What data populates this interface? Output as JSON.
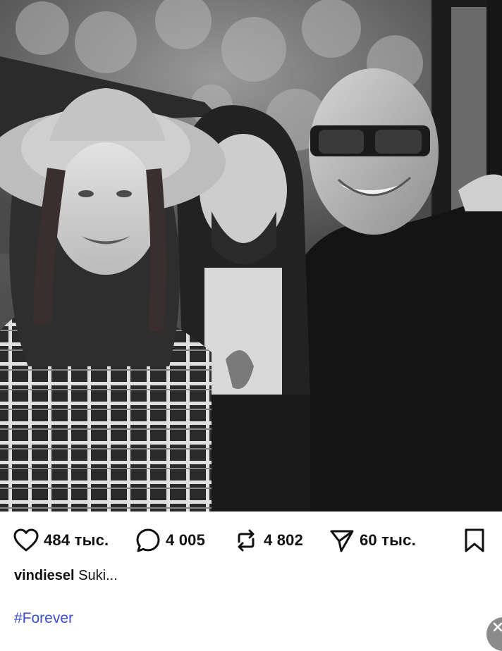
{
  "post": {
    "photo_icon": "photo-black-and-white",
    "actions": {
      "likes": "484 тыс.",
      "comments": "4 005",
      "reposts": "4 802",
      "shares": "60 тыс."
    },
    "caption": {
      "username": "vindiesel",
      "text": "Suki..."
    },
    "hashtag": "#Forever"
  },
  "icons": {
    "like": "heart-icon",
    "comment": "comment-bubble-icon",
    "repost": "repost-arrows-icon",
    "share": "send-icon",
    "save": "bookmark-icon",
    "close": "close-icon"
  },
  "colors": {
    "hashtag": "#3b4fd1",
    "text": "#111111",
    "fab": "#8b8b8b"
  }
}
